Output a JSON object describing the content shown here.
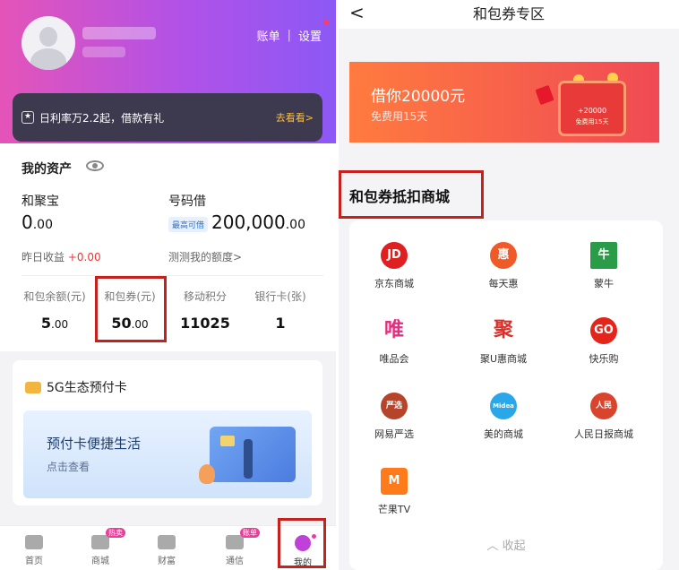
{
  "left": {
    "header": {
      "bill": "账单",
      "settings": "设置"
    },
    "promo": {
      "text": "日利率万2.2起，借款有礼",
      "cta": "去看看>"
    },
    "assets": {
      "title": "我的资产",
      "hejubao": {
        "label": "和聚宝",
        "int": "0",
        "dec": ".00",
        "sub_label": "昨日收益",
        "sub_value": "+0.00"
      },
      "haomajie": {
        "label": "号码借",
        "tag": "最高可借",
        "int": "200,000",
        "dec": ".00",
        "sub": "测测我的额度>"
      },
      "stats": [
        {
          "label": "和包余额(元)",
          "int": "5",
          "dec": ".00"
        },
        {
          "label": "和包券(元)",
          "int": "50",
          "dec": ".00"
        },
        {
          "label": "移动积分",
          "int": "11025",
          "dec": ""
        },
        {
          "label": "银行卡(张)",
          "int": "1",
          "dec": ""
        }
      ]
    },
    "card5g": {
      "title": "5G生态预付卡",
      "banner_title": "预付卡便捷生活",
      "banner_sub": "点击查看"
    },
    "tabbar": [
      {
        "label": "首页",
        "badge": ""
      },
      {
        "label": "商城",
        "badge": "热卖"
      },
      {
        "label": "财富",
        "badge": ""
      },
      {
        "label": "通信",
        "badge": "账单"
      },
      {
        "label": "我的",
        "badge": ""
      }
    ]
  },
  "right": {
    "title": "和包券专区",
    "back_glyph": "<",
    "banner": {
      "title": "借你20000元",
      "sub": "免费用15天",
      "chest_amount": "+20000",
      "chest_sub": "免费用15天"
    },
    "section_title": "和包券抵扣商城",
    "malls": [
      {
        "label": "京东商城",
        "icon": "JD",
        "color": "#e02020"
      },
      {
        "label": "每天惠",
        "icon": "惠",
        "color": "#f05a28"
      },
      {
        "label": "蒙牛",
        "icon": "牛",
        "color": "#2a9c47"
      },
      {
        "label": "唯品会",
        "icon": "唯",
        "color": "#e0307f"
      },
      {
        "label": "聚U惠商城",
        "icon": "聚",
        "color": "#d9302c"
      },
      {
        "label": "快乐购",
        "icon": "GO",
        "color": "#e4251b"
      },
      {
        "label": "网易严选",
        "icon": "严选",
        "color": "#b6442a"
      },
      {
        "label": "美的商城",
        "icon": "Midea",
        "color": "#2aa7e8"
      },
      {
        "label": "人民日报商城",
        "icon": "人民",
        "color": "#d9442d"
      },
      {
        "label": "芒果TV",
        "icon": "M",
        "color": "#ff7a1a"
      }
    ],
    "collapse": "收起"
  }
}
